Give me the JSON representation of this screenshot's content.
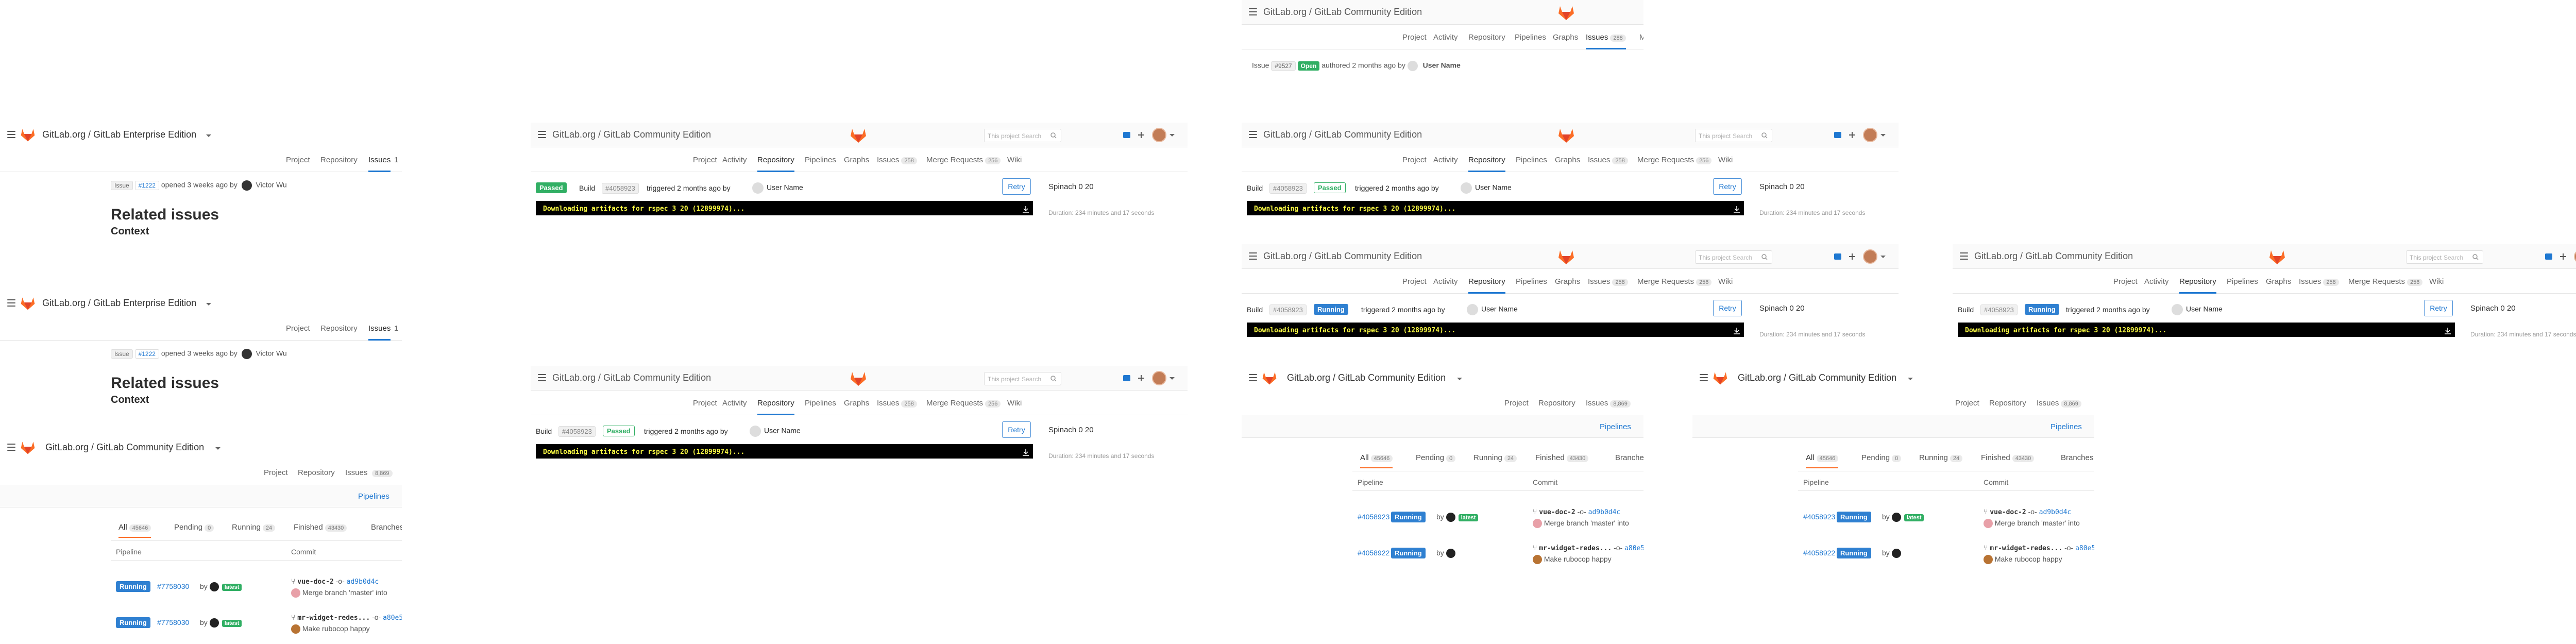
{
  "ee_title": "GitLab.org / GitLab Enterprise Edition",
  "ce_title": "GitLab.org / GitLab Community Edition",
  "project_tabs": [
    "Project",
    "Activity",
    "Repository",
    "Pipelines",
    "Graphs",
    "Issues",
    "Merge Requests",
    "Wiki"
  ],
  "issues_count": "258",
  "mr_count": "256",
  "search_scope": "This project",
  "search_placeholder": "Search",
  "build": {
    "label": "Build",
    "number": "#4058923",
    "status_passed": "Passed",
    "status_running": "Running",
    "triggered": "triggered 2 months ago by",
    "user": "User Name",
    "retry": "Retry",
    "log_line": "Downloading artifacts for rspec 3 20 (12899974)...",
    "runner": "Spinach 0 20",
    "duration": "Duration: 234 minutes and 17 seconds"
  },
  "issue_small": {
    "label": "Issue",
    "number": "#9527",
    "status": "Open",
    "authored": "authored 2 months ago by",
    "user": "User Name",
    "tabs": [
      "Project",
      "Activity",
      "Repository",
      "Pipelines",
      "Graphs",
      "Issues",
      "M"
    ],
    "issues_count": "288"
  },
  "ee_issue": {
    "tabs": [
      "Project",
      "Repository",
      "Issues"
    ],
    "issues_count": "1",
    "label": "Issue",
    "number": "#1222",
    "opened": "opened 3 weeks ago by",
    "user": "Victor Wu",
    "related": "Related issues",
    "context": "Context"
  },
  "pipelines": {
    "tabs": [
      "Project",
      "Repository",
      "Issues"
    ],
    "issues_count": "8,869",
    "crumb": "Pipelines",
    "filter_tabs": [
      {
        "label": "All",
        "count": "45646"
      },
      {
        "label": "Pending",
        "count": "0"
      },
      {
        "label": "Running",
        "count": "24"
      },
      {
        "label": "Finished",
        "count": "43430"
      },
      {
        "label": "Branches",
        "count": ""
      }
    ],
    "col_pipeline": "Pipeline",
    "col_commit": "Commit",
    "rows": [
      {
        "id": "#4058923",
        "id_b": "#7758030",
        "status": "Running",
        "by": "by",
        "latest": "latest",
        "branch": "vue-doc-2",
        "sha": "ad9b0d4c",
        "message": "Merge branch 'master' into"
      },
      {
        "id": "#4058922",
        "id_b": "#7758030",
        "status": "Running",
        "by": "by",
        "latest": "latest",
        "branch": "mr-widget-redes...",
        "sha": "a80e53f",
        "message": "Make rubocop happy"
      }
    ]
  }
}
